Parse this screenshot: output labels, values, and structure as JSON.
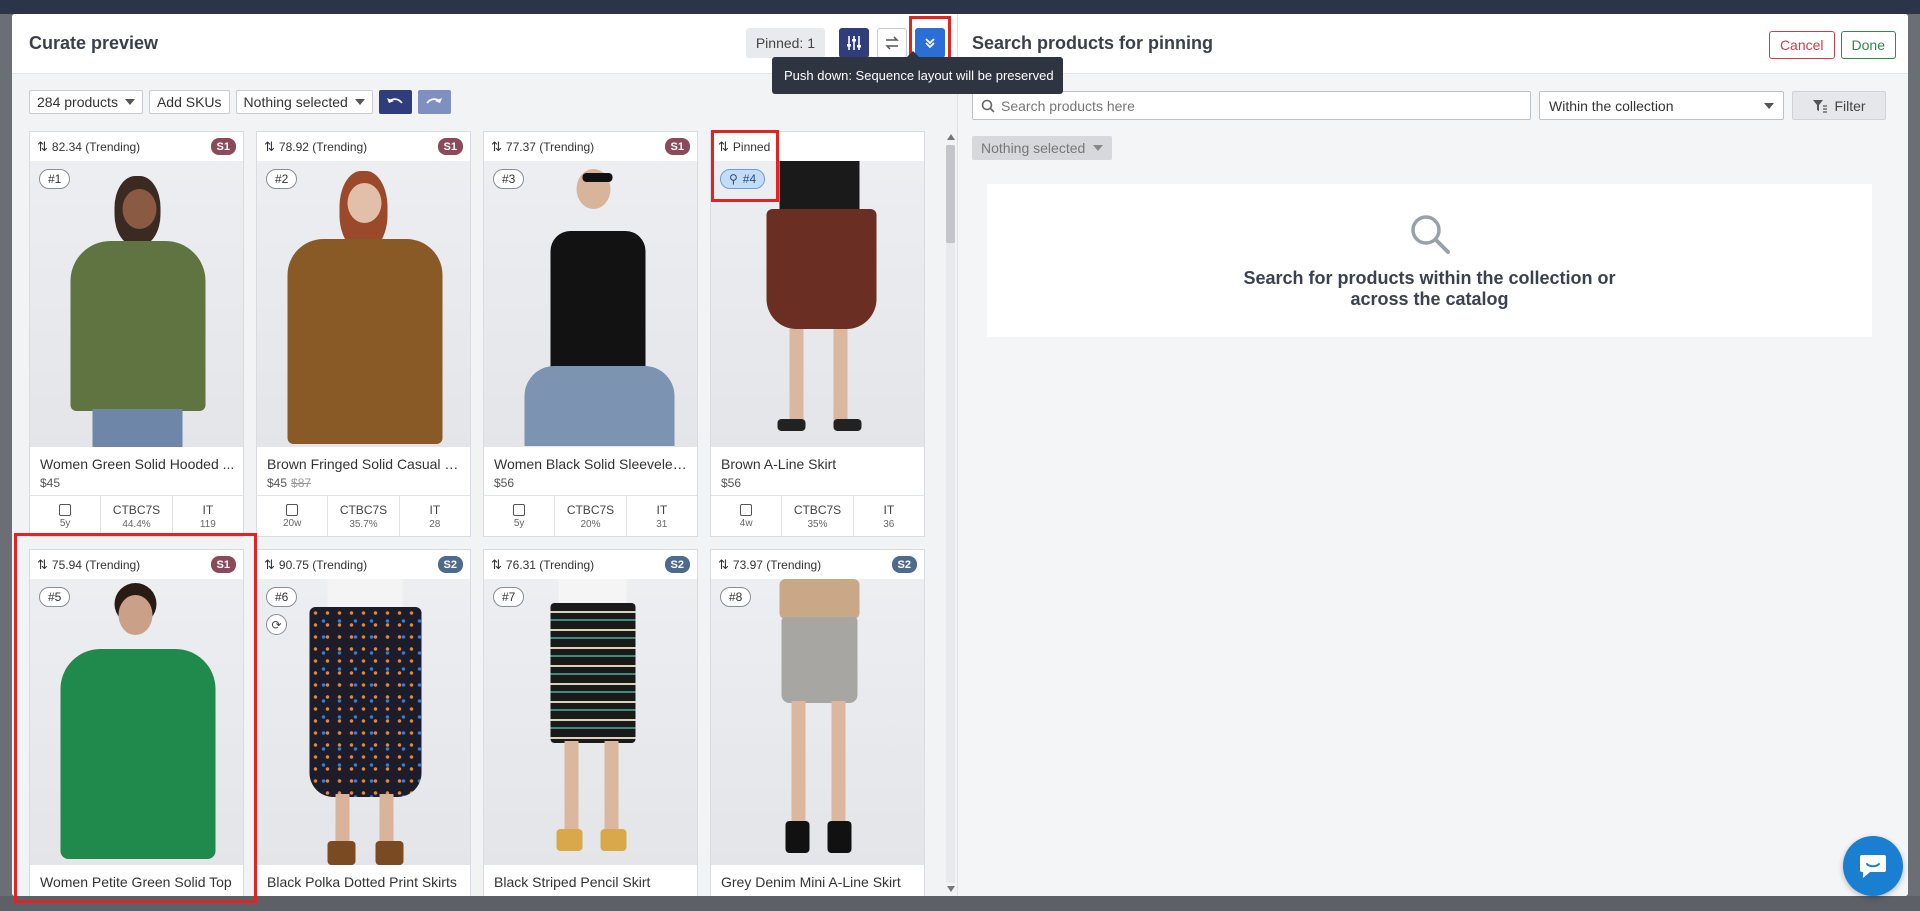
{
  "left": {
    "title": "Curate preview",
    "pinned_label": "Pinned: 1",
    "tooltip": "Push down: Sequence layout will be preserved",
    "toolbar": {
      "products_select": "284 products",
      "add_skus": "Add SKUs",
      "selection": "Nothing selected"
    },
    "cards": [
      {
        "score": "82.34 (Trending)",
        "segment": "S1",
        "rank": "#1",
        "name": "Women Green Solid Hooded ...",
        "price": "$45",
        "old_price": "",
        "age": "5y",
        "ctbc": "CTBC7S",
        "ctbc_val": "44.4%",
        "it": "IT",
        "it_val": "119"
      },
      {
        "score": "78.92 (Trending)",
        "segment": "S1",
        "rank": "#2",
        "name": "Brown Fringed Solid Casual S...",
        "price": "$45",
        "old_price": "$87",
        "age": "20w",
        "ctbc": "CTBC7S",
        "ctbc_val": "35.7%",
        "it": "IT",
        "it_val": "28"
      },
      {
        "score": "77.37 (Trending)",
        "segment": "S1",
        "rank": "#3",
        "name": "Women Black Solid Sleeveles...",
        "price": "$56",
        "old_price": "",
        "age": "5y",
        "ctbc": "CTBC7S",
        "ctbc_val": "20%",
        "it": "IT",
        "it_val": "31"
      },
      {
        "score": "Pinned",
        "segment": "",
        "rank": "#4",
        "name": "Brown A-Line Skirt",
        "price": "$56",
        "old_price": "",
        "age": "4w",
        "ctbc": "CTBC7S",
        "ctbc_val": "35%",
        "it": "IT",
        "it_val": "36"
      },
      {
        "score": "75.94 (Trending)",
        "segment": "S1",
        "rank": "#5",
        "name": "Women Petite Green Solid Top",
        "price": "",
        "old_price": "",
        "age": "",
        "ctbc": "",
        "ctbc_val": "",
        "it": "",
        "it_val": ""
      },
      {
        "score": "90.75 (Trending)",
        "segment": "S2",
        "rank": "#6",
        "name": "Black Polka Dotted Print Skirts",
        "price": "",
        "old_price": "",
        "age": "",
        "ctbc": "",
        "ctbc_val": "",
        "it": "",
        "it_val": ""
      },
      {
        "score": "76.31 (Trending)",
        "segment": "S2",
        "rank": "#7",
        "name": "Black Striped Pencil Skirt",
        "price": "",
        "old_price": "",
        "age": "",
        "ctbc": "",
        "ctbc_val": "",
        "it": "",
        "it_val": ""
      },
      {
        "score": "73.97 (Trending)",
        "segment": "S2",
        "rank": "#8",
        "name": "Grey Denim Mini A-Line Skirt",
        "price": "",
        "old_price": "",
        "age": "",
        "ctbc": "",
        "ctbc_val": "",
        "it": "",
        "it_val": ""
      }
    ]
  },
  "right": {
    "title": "Search products for pinning",
    "cancel": "Cancel",
    "done": "Done",
    "search_value": "",
    "search_placeholder": "Search products here",
    "scope_select": "Within the collection",
    "filter": "Filter",
    "selection": "Nothing selected",
    "empty_message": "Search for products within the collection or across the catalog"
  },
  "colors": {
    "navy": "#2f3d7a",
    "accent_blue": "#2b6fd6",
    "segment_s1": "#8a4a5c",
    "segment_s2": "#4e6a8c",
    "highlight": "#e02424",
    "cancel_red": "#cf3e48",
    "done_green": "#2e8b4c"
  }
}
